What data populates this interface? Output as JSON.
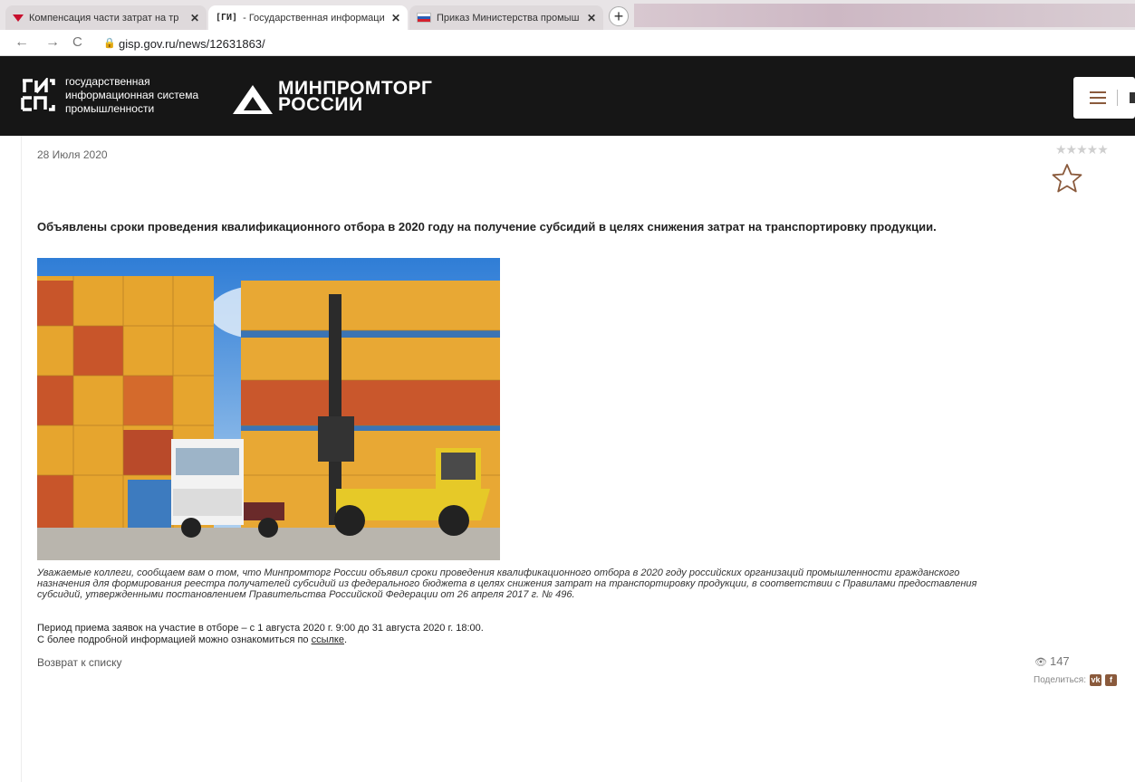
{
  "browser": {
    "tabs": [
      {
        "title": "Компенсация части затрат на тр",
        "active": false,
        "icon": "red-triangle-favicon"
      },
      {
        "title": "- Государственная информаци",
        "active": true,
        "icon": "gisp-favicon"
      },
      {
        "title": "Приказ Министерства промыш",
        "active": false,
        "icon": "russia-flag-favicon"
      }
    ],
    "new_tab_label": "+",
    "url": "gisp.gov.ru/news/12631863/"
  },
  "header": {
    "gisp_logo_text": [
      "государственная",
      "информационная система",
      "промышленности"
    ],
    "ministry_name": [
      "МИНПРОМТОРГ",
      "РОССИИ"
    ]
  },
  "article": {
    "date": "28 Июля 2020",
    "rating_stars": "★★★★★",
    "headline": "Объявлены сроки проведения квалификационного отбора в 2020 году на получение субсидий в целях снижения затрат на транспортировку продукции.",
    "lead_lines": [
      "Уважаемые коллеги, сообщаем вам о том, что Минпромторг России объявил сроки проведения квалификационного отбора в 2020 году российских организаций промышленности гражданского",
      "назначения для формирования реестра получателей субсидий из федерального бюджета в целях снижения затрат на транспортировку продукции, в соответствии с Правилами предоставления",
      "субсидий, утвержденными постановлением Правительства Российской Федерации от 26 апреля 2017 г. № 496."
    ],
    "period_text": "Период приема заявок на участие в отборе – с 1 августа 2020 г. 9:00 до 31 августа 2020 г. 18:00.",
    "more_info_text": "С более подробной информацией можно ознакомиться по ",
    "more_info_link": "ссылке",
    "more_info_end": ".",
    "back_link": "Возврат к списку",
    "views": "147",
    "share_label": "Поделиться:",
    "share_vk": "vk",
    "share_fb": "f"
  },
  "colors": {
    "header_bg": "#161616",
    "accent_brown": "#8a5a3c"
  }
}
